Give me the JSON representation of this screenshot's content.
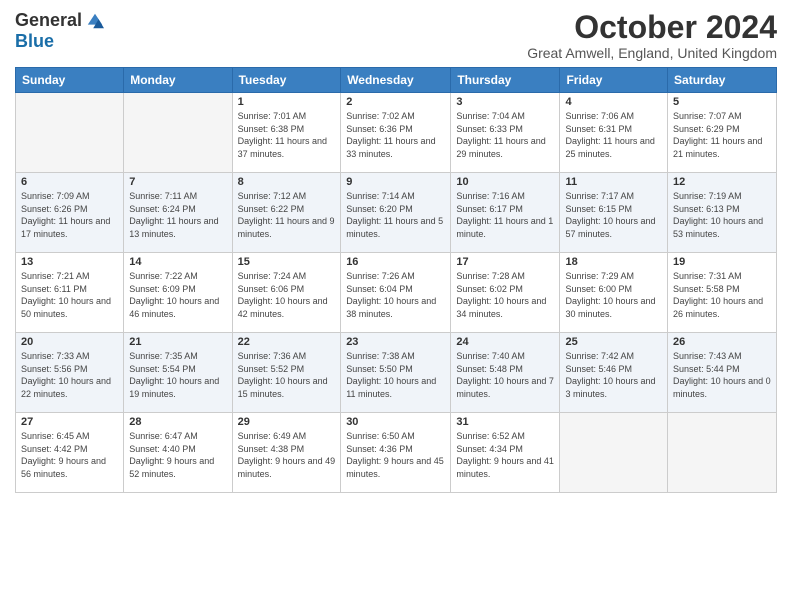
{
  "logo": {
    "general": "General",
    "blue": "Blue"
  },
  "header": {
    "month": "October 2024",
    "location": "Great Amwell, England, United Kingdom"
  },
  "weekdays": [
    "Sunday",
    "Monday",
    "Tuesday",
    "Wednesday",
    "Thursday",
    "Friday",
    "Saturday"
  ],
  "weeks": [
    [
      {
        "day": "",
        "info": ""
      },
      {
        "day": "",
        "info": ""
      },
      {
        "day": "1",
        "info": "Sunrise: 7:01 AM\nSunset: 6:38 PM\nDaylight: 11 hours and 37 minutes."
      },
      {
        "day": "2",
        "info": "Sunrise: 7:02 AM\nSunset: 6:36 PM\nDaylight: 11 hours and 33 minutes."
      },
      {
        "day": "3",
        "info": "Sunrise: 7:04 AM\nSunset: 6:33 PM\nDaylight: 11 hours and 29 minutes."
      },
      {
        "day": "4",
        "info": "Sunrise: 7:06 AM\nSunset: 6:31 PM\nDaylight: 11 hours and 25 minutes."
      },
      {
        "day": "5",
        "info": "Sunrise: 7:07 AM\nSunset: 6:29 PM\nDaylight: 11 hours and 21 minutes."
      }
    ],
    [
      {
        "day": "6",
        "info": "Sunrise: 7:09 AM\nSunset: 6:26 PM\nDaylight: 11 hours and 17 minutes."
      },
      {
        "day": "7",
        "info": "Sunrise: 7:11 AM\nSunset: 6:24 PM\nDaylight: 11 hours and 13 minutes."
      },
      {
        "day": "8",
        "info": "Sunrise: 7:12 AM\nSunset: 6:22 PM\nDaylight: 11 hours and 9 minutes."
      },
      {
        "day": "9",
        "info": "Sunrise: 7:14 AM\nSunset: 6:20 PM\nDaylight: 11 hours and 5 minutes."
      },
      {
        "day": "10",
        "info": "Sunrise: 7:16 AM\nSunset: 6:17 PM\nDaylight: 11 hours and 1 minute."
      },
      {
        "day": "11",
        "info": "Sunrise: 7:17 AM\nSunset: 6:15 PM\nDaylight: 10 hours and 57 minutes."
      },
      {
        "day": "12",
        "info": "Sunrise: 7:19 AM\nSunset: 6:13 PM\nDaylight: 10 hours and 53 minutes."
      }
    ],
    [
      {
        "day": "13",
        "info": "Sunrise: 7:21 AM\nSunset: 6:11 PM\nDaylight: 10 hours and 50 minutes."
      },
      {
        "day": "14",
        "info": "Sunrise: 7:22 AM\nSunset: 6:09 PM\nDaylight: 10 hours and 46 minutes."
      },
      {
        "day": "15",
        "info": "Sunrise: 7:24 AM\nSunset: 6:06 PM\nDaylight: 10 hours and 42 minutes."
      },
      {
        "day": "16",
        "info": "Sunrise: 7:26 AM\nSunset: 6:04 PM\nDaylight: 10 hours and 38 minutes."
      },
      {
        "day": "17",
        "info": "Sunrise: 7:28 AM\nSunset: 6:02 PM\nDaylight: 10 hours and 34 minutes."
      },
      {
        "day": "18",
        "info": "Sunrise: 7:29 AM\nSunset: 6:00 PM\nDaylight: 10 hours and 30 minutes."
      },
      {
        "day": "19",
        "info": "Sunrise: 7:31 AM\nSunset: 5:58 PM\nDaylight: 10 hours and 26 minutes."
      }
    ],
    [
      {
        "day": "20",
        "info": "Sunrise: 7:33 AM\nSunset: 5:56 PM\nDaylight: 10 hours and 22 minutes."
      },
      {
        "day": "21",
        "info": "Sunrise: 7:35 AM\nSunset: 5:54 PM\nDaylight: 10 hours and 19 minutes."
      },
      {
        "day": "22",
        "info": "Sunrise: 7:36 AM\nSunset: 5:52 PM\nDaylight: 10 hours and 15 minutes."
      },
      {
        "day": "23",
        "info": "Sunrise: 7:38 AM\nSunset: 5:50 PM\nDaylight: 10 hours and 11 minutes."
      },
      {
        "day": "24",
        "info": "Sunrise: 7:40 AM\nSunset: 5:48 PM\nDaylight: 10 hours and 7 minutes."
      },
      {
        "day": "25",
        "info": "Sunrise: 7:42 AM\nSunset: 5:46 PM\nDaylight: 10 hours and 3 minutes."
      },
      {
        "day": "26",
        "info": "Sunrise: 7:43 AM\nSunset: 5:44 PM\nDaylight: 10 hours and 0 minutes."
      }
    ],
    [
      {
        "day": "27",
        "info": "Sunrise: 6:45 AM\nSunset: 4:42 PM\nDaylight: 9 hours and 56 minutes."
      },
      {
        "day": "28",
        "info": "Sunrise: 6:47 AM\nSunset: 4:40 PM\nDaylight: 9 hours and 52 minutes."
      },
      {
        "day": "29",
        "info": "Sunrise: 6:49 AM\nSunset: 4:38 PM\nDaylight: 9 hours and 49 minutes."
      },
      {
        "day": "30",
        "info": "Sunrise: 6:50 AM\nSunset: 4:36 PM\nDaylight: 9 hours and 45 minutes."
      },
      {
        "day": "31",
        "info": "Sunrise: 6:52 AM\nSunset: 4:34 PM\nDaylight: 9 hours and 41 minutes."
      },
      {
        "day": "",
        "info": ""
      },
      {
        "day": "",
        "info": ""
      }
    ]
  ]
}
